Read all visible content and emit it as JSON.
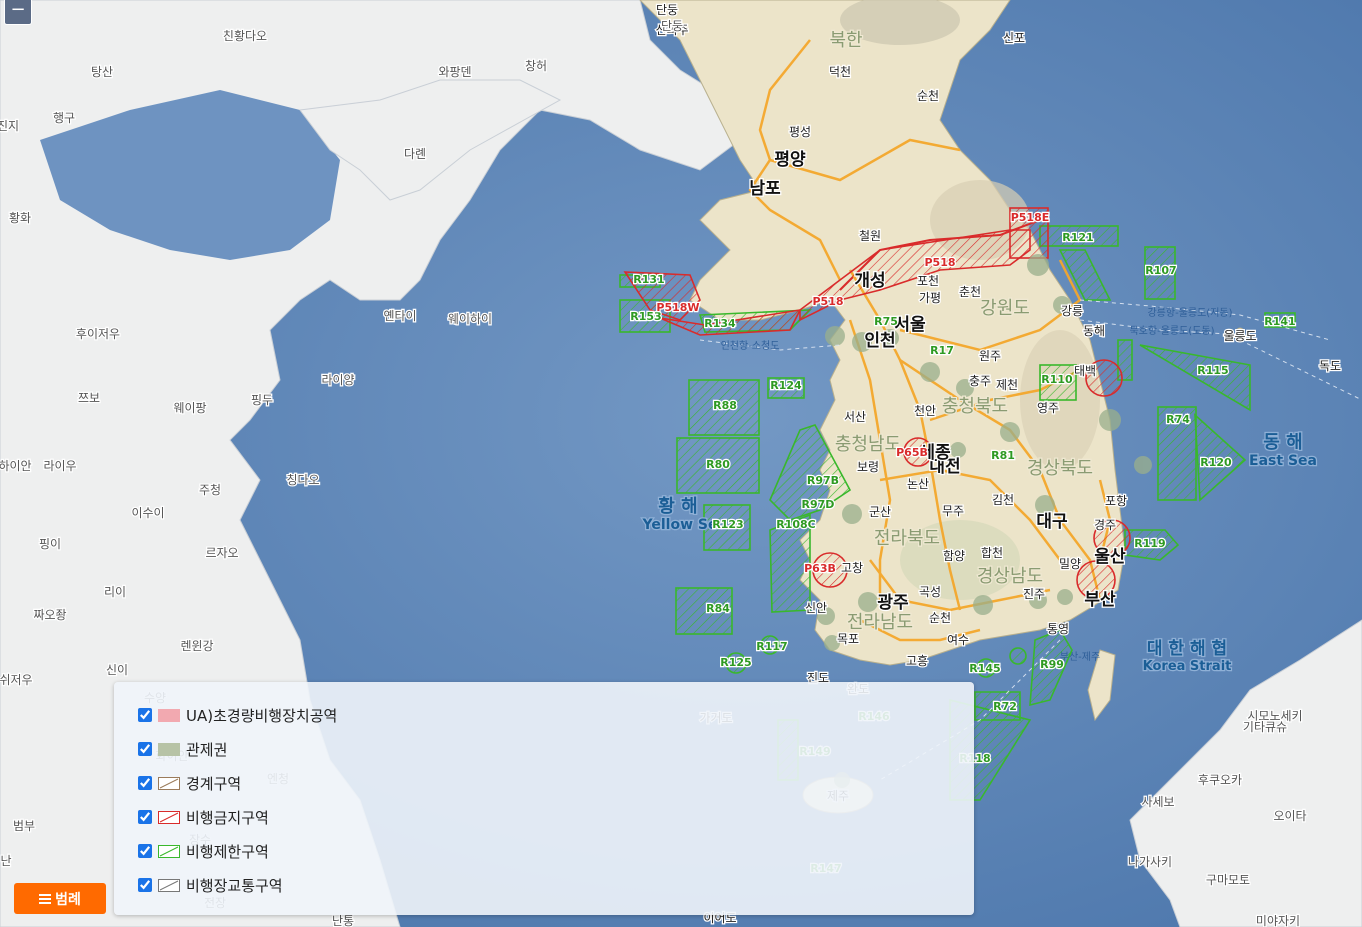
{
  "map": {
    "colors": {
      "sea": "#5f87b8",
      "land_china": "#eef0f0",
      "land_korea": "#efe6cf",
      "restricted": "#39b82c",
      "prohibited": "#d92b2b",
      "road": "#f4a72c"
    },
    "place_labels_sea": [
      "황 해",
      "Yellow Se",
      "동 해",
      "East Sea",
      "대 한 해 협",
      "Korea Strait"
    ],
    "cities_major": [
      "평양",
      "남포",
      "개성",
      "서울",
      "인천",
      "대전",
      "세종",
      "대구",
      "울산",
      "부산",
      "광주"
    ],
    "cities_minor": [
      "단둥",
      "신의주",
      "덕천",
      "순천",
      "평성",
      "철원",
      "포천",
      "춘천",
      "가평",
      "원주",
      "충주",
      "천안",
      "서산",
      "보령",
      "논산",
      "군산",
      "고창",
      "신안",
      "목포",
      "순천",
      "여수",
      "고흥",
      "진주",
      "통영",
      "밀양",
      "경주",
      "포항",
      "동해",
      "강릉",
      "태백",
      "영주",
      "제천",
      "김천",
      "무주",
      "함양",
      "합천",
      "곡성",
      "신포",
      "울릉도",
      "독도",
      "진도",
      "완도",
      "가거도",
      "제주",
      "이어도"
    ],
    "provinces": [
      "북한",
      "강원도",
      "충청북도",
      "충청남도",
      "경상북도",
      "전라북도",
      "경상남도",
      "전라남도"
    ],
    "china_labels": [
      "친황다오",
      "탕산",
      "행구",
      "진지",
      "황화",
      "와팡덴",
      "창허",
      "다롄",
      "단둥",
      "후이저우",
      "옌타이",
      "웨이하이",
      "라이양",
      "쯔보",
      "웨이팡",
      "핑두",
      "칭다오",
      "주청",
      "이수이",
      "라이우",
      "하이안",
      "르자오",
      "핑이",
      "리이",
      "짜오좡",
      "렌윈강",
      "신이",
      "쉬저우",
      "수양",
      "화이안",
      "엔청",
      "장수",
      "범부",
      "난",
      "전장",
      "난통"
    ],
    "japan_labels": [
      "시모노세키",
      "기타큐슈",
      "후쿠오카",
      "사세보",
      "오이타",
      "나가사키",
      "구마모토",
      "미야자키"
    ],
    "zones_restricted": [
      "R121",
      "R107",
      "R131",
      "R153",
      "R134",
      "R75",
      "R17",
      "R141",
      "R115",
      "R110",
      "R124",
      "R88",
      "R74",
      "R80",
      "R97B",
      "R81",
      "R120",
      "R97D",
      "R123",
      "R108C",
      "R119",
      "R84",
      "R117",
      "R125",
      "R145",
      "R99",
      "R72",
      "R146",
      "R149",
      "R118",
      "R147"
    ],
    "zones_prohibited": [
      "P518E",
      "P518",
      "P518W",
      "P65B",
      "P63B"
    ],
    "routes": [
      "강릉항-울릉도(저동)",
      "묵호항-울릉도(도동)",
      "인천항-소청도",
      "부산-제주"
    ]
  },
  "zoom": {
    "out_label": "−"
  },
  "legend": {
    "items": [
      {
        "label": "UA)초경량비행장치공역",
        "checked": true,
        "swatch": "ua"
      },
      {
        "label": "관제권",
        "checked": true,
        "swatch": "control"
      },
      {
        "label": "경계구역",
        "checked": true,
        "swatch": "alert"
      },
      {
        "label": "비행금지구역",
        "checked": true,
        "swatch": "prohibited"
      },
      {
        "label": "비행제한구역",
        "checked": true,
        "swatch": "restricted"
      },
      {
        "label": "비행장교통구역",
        "checked": true,
        "swatch": "atz"
      }
    ],
    "button_label": "범례"
  }
}
